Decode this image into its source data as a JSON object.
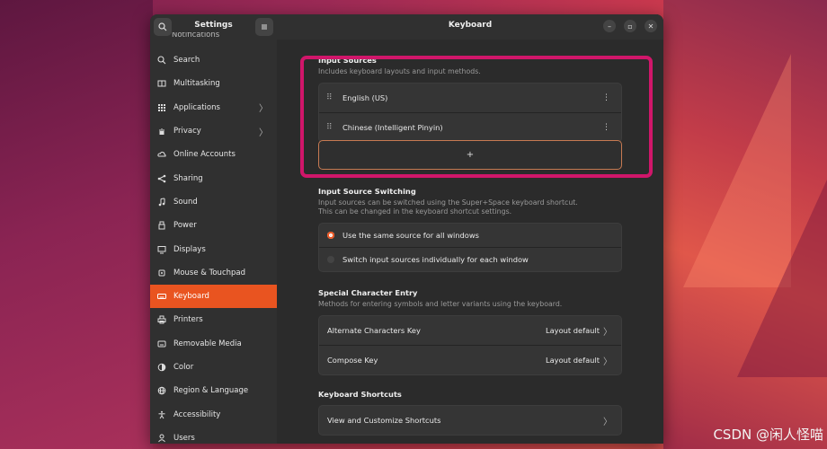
{
  "sidebar": {
    "title": "Settings",
    "cut_item": "Notifications",
    "items": [
      {
        "label": "Search",
        "icon": "search-icon",
        "chevron": false,
        "active": false
      },
      {
        "label": "Multitasking",
        "icon": "multitasking-icon",
        "chevron": false,
        "active": false
      },
      {
        "label": "Applications",
        "icon": "applications-icon",
        "chevron": true,
        "active": false
      },
      {
        "label": "Privacy",
        "icon": "hand-icon",
        "chevron": true,
        "active": false
      },
      {
        "label": "Online Accounts",
        "icon": "cloud-icon",
        "chevron": false,
        "active": false
      },
      {
        "label": "Sharing",
        "icon": "share-icon",
        "chevron": false,
        "active": false
      },
      {
        "label": "Sound",
        "icon": "music-note-icon",
        "chevron": false,
        "active": false
      },
      {
        "label": "Power",
        "icon": "power-icon",
        "chevron": false,
        "active": false
      },
      {
        "label": "Displays",
        "icon": "display-icon",
        "chevron": false,
        "active": false
      },
      {
        "label": "Mouse & Touchpad",
        "icon": "mouse-icon",
        "chevron": false,
        "active": false
      },
      {
        "label": "Keyboard",
        "icon": "keyboard-icon",
        "chevron": false,
        "active": true
      },
      {
        "label": "Printers",
        "icon": "printer-icon",
        "chevron": false,
        "active": false
      },
      {
        "label": "Removable Media",
        "icon": "media-icon",
        "chevron": false,
        "active": false
      },
      {
        "label": "Color",
        "icon": "color-icon",
        "chevron": false,
        "active": false
      },
      {
        "label": "Region & Language",
        "icon": "globe-icon",
        "chevron": false,
        "active": false
      },
      {
        "label": "Accessibility",
        "icon": "accessibility-icon",
        "chevron": false,
        "active": false
      },
      {
        "label": "Users",
        "icon": "users-icon",
        "chevron": false,
        "active": false
      }
    ]
  },
  "main": {
    "title": "Keyboard",
    "input_sources": {
      "title": "Input Sources",
      "subtitle": "Includes keyboard layouts and input methods.",
      "sources": [
        "English (US)",
        "Chinese (Intelligent Pinyin)"
      ],
      "add_label": "+"
    },
    "switching": {
      "title": "Input Source Switching",
      "subtitle": "Input sources can be switched using the Super+Space keyboard shortcut.\nThis can be changed in the keyboard shortcut settings.",
      "option_same": "Use the same source for all windows",
      "option_each": "Switch input sources individually for each window"
    },
    "special": {
      "title": "Special Character Entry",
      "subtitle": "Methods for entering symbols and letter variants using the keyboard.",
      "alt_label": "Alternate Characters Key",
      "alt_value": "Layout default",
      "compose_label": "Compose Key",
      "compose_value": "Layout default"
    },
    "shortcuts": {
      "title": "Keyboard Shortcuts",
      "view_label": "View and Customize Shortcuts"
    }
  },
  "watermark": "CSDN @闲人怪喵",
  "colors": {
    "accent": "#e95420",
    "highlight": "#d0166a"
  }
}
